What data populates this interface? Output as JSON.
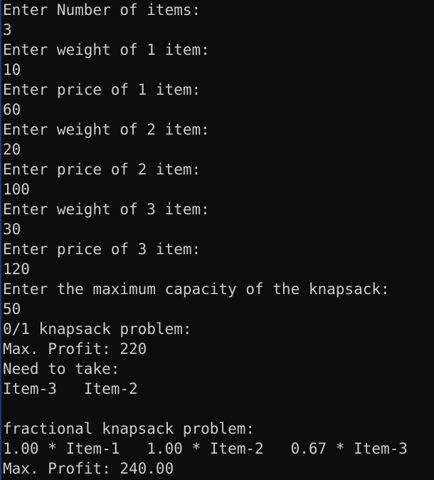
{
  "console": {
    "lines": [
      "Enter Number of items:",
      "3",
      "Enter weight of 1 item:",
      "10",
      "Enter price of 1 item:",
      "60",
      "Enter weight of 2 item:",
      "20",
      "Enter price of 2 item:",
      "100",
      "Enter weight of 3 item:",
      "30",
      "Enter price of 3 item:",
      "120",
      "Enter the maximum capacity of the knapsack:",
      "50",
      "0/1 knapsack problem:",
      "Max. Profit: 220",
      "Need to take:",
      "Item-3   Item-2",
      "",
      "fractional knapsack problem:",
      "1.00 * Item-1   1.00 * Item-2   0.67 * Item-3",
      "Max. Profit: 240.00"
    ]
  }
}
